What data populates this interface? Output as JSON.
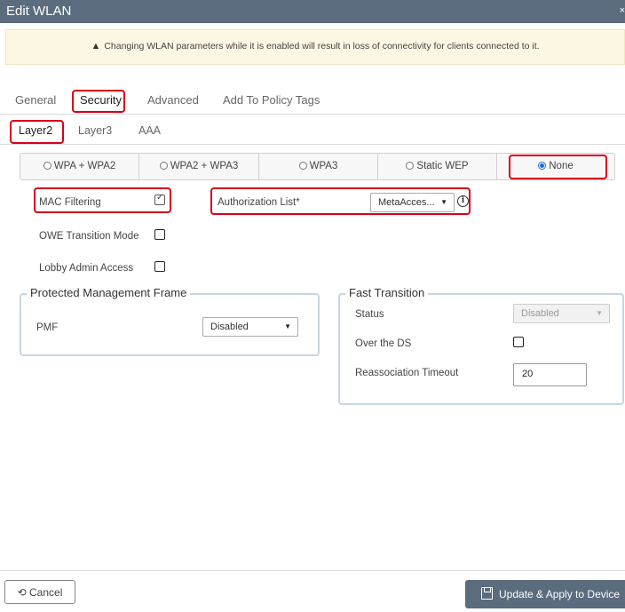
{
  "dialog": {
    "title": "Edit WLAN",
    "close_glyph": "×"
  },
  "warning": {
    "icon": "warning-triangle-icon",
    "text": "Changing WLAN parameters while it is enabled will result in loss of connectivity for clients connected to it."
  },
  "tabs": [
    {
      "label": "General"
    },
    {
      "label": "Security",
      "active": true
    },
    {
      "label": "Advanced"
    },
    {
      "label": "Add To Policy Tags"
    }
  ],
  "subtabs": [
    {
      "label": "Layer2",
      "active": true
    },
    {
      "label": "Layer3"
    },
    {
      "label": "AAA"
    }
  ],
  "security_mode": {
    "options": [
      {
        "label": "WPA + WPA2",
        "selected": false
      },
      {
        "label": "WPA2 + WPA3",
        "selected": false
      },
      {
        "label": "WPA3",
        "selected": false
      },
      {
        "label": "Static WEP",
        "selected": false
      },
      {
        "label": "None",
        "selected": true
      }
    ]
  },
  "layer2": {
    "mac_filtering": {
      "label": "MAC Filtering",
      "checked": true
    },
    "authorization_list": {
      "label": "Authorization List*",
      "value": "MetaAcces..."
    },
    "owe_transition": {
      "label": "OWE Transition Mode",
      "checked": false
    },
    "lobby_admin": {
      "label": "Lobby Admin Access",
      "checked": false
    }
  },
  "pmf_section": {
    "title": "Protected Management Frame",
    "pmf": {
      "label": "PMF",
      "value": "Disabled"
    }
  },
  "fast_transition": {
    "title": "Fast Transition",
    "status": {
      "label": "Status",
      "value": "Disabled"
    },
    "over_the_ds": {
      "label": "Over the DS",
      "checked": false
    },
    "reassociation_timeout": {
      "label": "Reassociation Timeout",
      "value": "20"
    }
  },
  "footer": {
    "cancel_label": "Cancel",
    "cancel_icon": "undo-icon",
    "update_label": "Update & Apply to Device",
    "update_icon": "save-icon"
  },
  "colors": {
    "highlight": "#d9001b",
    "header": "#5a6c7d",
    "radio_selected": "#1d6fd8"
  }
}
